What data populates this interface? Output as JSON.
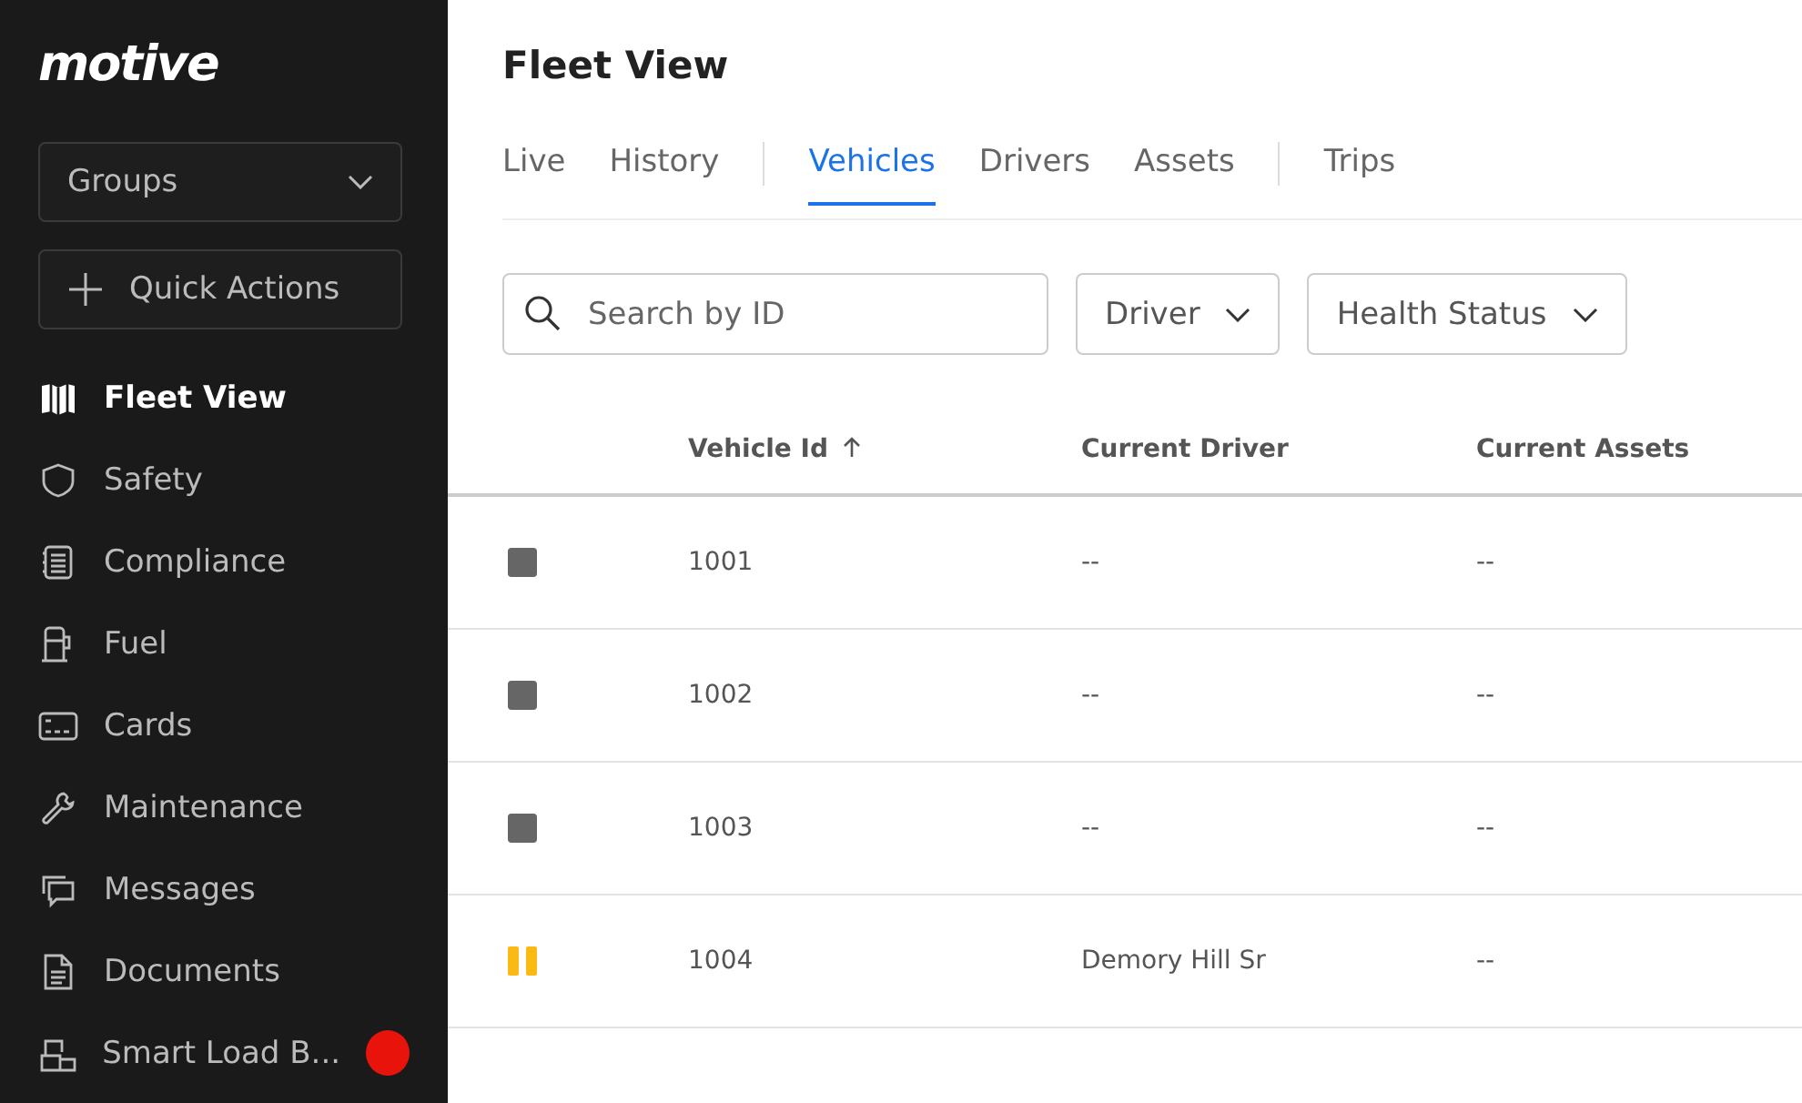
{
  "sidebar": {
    "logo": "motive",
    "groups_dropdown": {
      "label": "Groups"
    },
    "quick_actions": {
      "label": "Quick Actions"
    },
    "items": [
      {
        "label": "Fleet View",
        "selected": true,
        "notification": false
      },
      {
        "label": "Safety",
        "selected": false,
        "notification": false
      },
      {
        "label": "Compliance",
        "selected": false,
        "notification": false
      },
      {
        "label": "Fuel",
        "selected": false,
        "notification": false
      },
      {
        "label": "Cards",
        "selected": false,
        "notification": false
      },
      {
        "label": "Maintenance",
        "selected": false,
        "notification": false
      },
      {
        "label": "Messages",
        "selected": false,
        "notification": false
      },
      {
        "label": "Documents",
        "selected": false,
        "notification": false
      },
      {
        "label": "Smart Load B...",
        "selected": false,
        "notification": true
      }
    ]
  },
  "page": {
    "title": "Fleet View",
    "tab_groups": [
      {
        "tabs": [
          {
            "label": "Live",
            "selected": false
          },
          {
            "label": "History",
            "selected": false
          }
        ]
      },
      {
        "tabs": [
          {
            "label": "Vehicles",
            "selected": true
          },
          {
            "label": "Drivers",
            "selected": false
          },
          {
            "label": "Assets",
            "selected": false
          }
        ]
      },
      {
        "tabs": [
          {
            "label": "Trips",
            "selected": false
          }
        ]
      }
    ],
    "search": {
      "placeholder": "Search by ID"
    },
    "filters": [
      {
        "label": "Driver"
      },
      {
        "label": "Health Status"
      }
    ],
    "table": {
      "columns": [
        {
          "label": "Vehicle Id",
          "sorted": true
        },
        {
          "label": "Current Driver",
          "sorted": false
        },
        {
          "label": "Current Assets",
          "sorted": false
        }
      ],
      "rows": [
        {
          "kind": "stopped",
          "vehicle_id": "1001",
          "driver": "--",
          "assets": "--"
        },
        {
          "kind": "stopped",
          "vehicle_id": "1002",
          "driver": "--",
          "assets": "--"
        },
        {
          "kind": "stopped",
          "vehicle_id": "1003",
          "driver": "--",
          "assets": "--"
        },
        {
          "kind": "idle",
          "vehicle_id": "1004",
          "driver": "Demory Hill Sr",
          "assets": "--"
        }
      ]
    }
  }
}
